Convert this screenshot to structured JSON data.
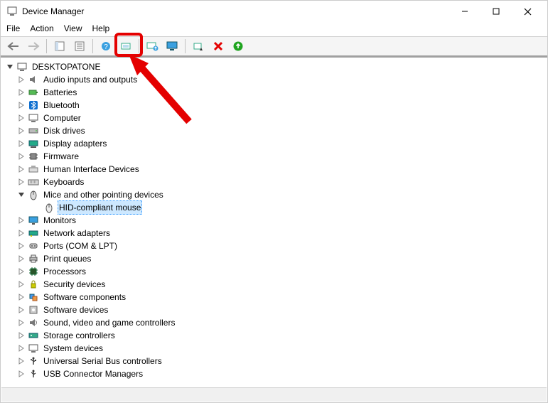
{
  "window": {
    "title": "Device Manager"
  },
  "menu": {
    "file": "File",
    "action": "Action",
    "view": "View",
    "help": "Help"
  },
  "tree": {
    "root": "DESKTOPATONE",
    "items": [
      {
        "label": "Audio inputs and outputs",
        "expanded": false
      },
      {
        "label": "Batteries",
        "expanded": false
      },
      {
        "label": "Bluetooth",
        "expanded": false
      },
      {
        "label": "Computer",
        "expanded": false
      },
      {
        "label": "Disk drives",
        "expanded": false
      },
      {
        "label": "Display adapters",
        "expanded": false
      },
      {
        "label": "Firmware",
        "expanded": false
      },
      {
        "label": "Human Interface Devices",
        "expanded": false
      },
      {
        "label": "Keyboards",
        "expanded": false
      },
      {
        "label": "Mice and other pointing devices",
        "expanded": true,
        "children": [
          {
            "label": "HID-compliant mouse",
            "selected": true
          }
        ]
      },
      {
        "label": "Monitors",
        "expanded": false
      },
      {
        "label": "Network adapters",
        "expanded": false
      },
      {
        "label": "Ports (COM & LPT)",
        "expanded": false
      },
      {
        "label": "Print queues",
        "expanded": false
      },
      {
        "label": "Processors",
        "expanded": false
      },
      {
        "label": "Security devices",
        "expanded": false
      },
      {
        "label": "Software components",
        "expanded": false
      },
      {
        "label": "Software devices",
        "expanded": false
      },
      {
        "label": "Sound, video and game controllers",
        "expanded": false
      },
      {
        "label": "Storage controllers",
        "expanded": false
      },
      {
        "label": "System devices",
        "expanded": false
      },
      {
        "label": "Universal Serial Bus controllers",
        "expanded": false
      },
      {
        "label": "USB Connector Managers",
        "expanded": false
      }
    ]
  }
}
